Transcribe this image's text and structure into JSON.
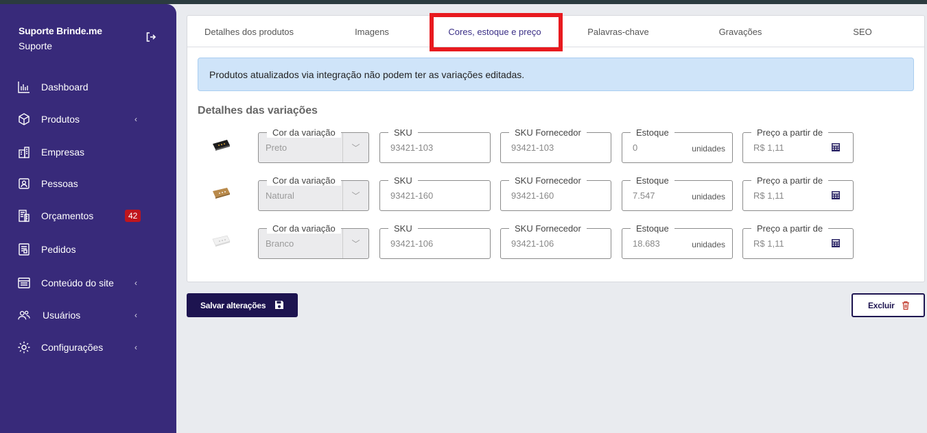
{
  "sidebar": {
    "brand": "Suporte Brinde.me",
    "subtitle": "Suporte",
    "items": [
      {
        "label": "Dashboard",
        "icon": "chart-icon"
      },
      {
        "label": "Produtos",
        "icon": "box-icon"
      },
      {
        "label": "Empresas",
        "icon": "building-icon"
      },
      {
        "label": "Pessoas",
        "icon": "person-card-icon"
      },
      {
        "label": "Orçamentos",
        "icon": "calculator-doc-icon",
        "badge": "42"
      },
      {
        "label": "Pedidos",
        "icon": "document-icon"
      },
      {
        "label": "Conteúdo do site",
        "icon": "layout-icon"
      },
      {
        "label": "Usuários",
        "icon": "users-icon"
      },
      {
        "label": "Configurações",
        "icon": "gear-icon"
      }
    ]
  },
  "tabs": [
    {
      "label": "Detalhes dos produtos"
    },
    {
      "label": "Imagens"
    },
    {
      "label": "Cores, estoque e preço"
    },
    {
      "label": "Palavras-chave"
    },
    {
      "label": "Gravações"
    },
    {
      "label": "SEO"
    }
  ],
  "alert": "Produtos atualizados via integração não podem ter as variações editadas.",
  "section_title": "Detalhes das variações",
  "labels": {
    "color": "Cor da variação",
    "sku": "SKU",
    "sku_supplier": "SKU Fornecedor",
    "stock": "Estoque",
    "price": "Preço a partir de",
    "unit": "unidades"
  },
  "variations": [
    {
      "color": "Preto",
      "sku": "93421-103",
      "sku_supplier": "93421-103",
      "stock": "0",
      "price": "R$ 1,11"
    },
    {
      "color": "Natural",
      "sku": "93421-160",
      "sku_supplier": "93421-160",
      "stock": "7.547",
      "price": "R$ 1,11"
    },
    {
      "color": "Branco",
      "sku": "93421-106",
      "sku_supplier": "93421-106",
      "stock": "18.683",
      "price": "R$ 1,11"
    }
  ],
  "buttons": {
    "save": "Salvar alterações",
    "delete": "Excluir"
  },
  "colors": {
    "sidebar": "#382a7a",
    "primary": "#1d1450",
    "highlight": "#e81a1f",
    "badge": "#c0151d"
  }
}
